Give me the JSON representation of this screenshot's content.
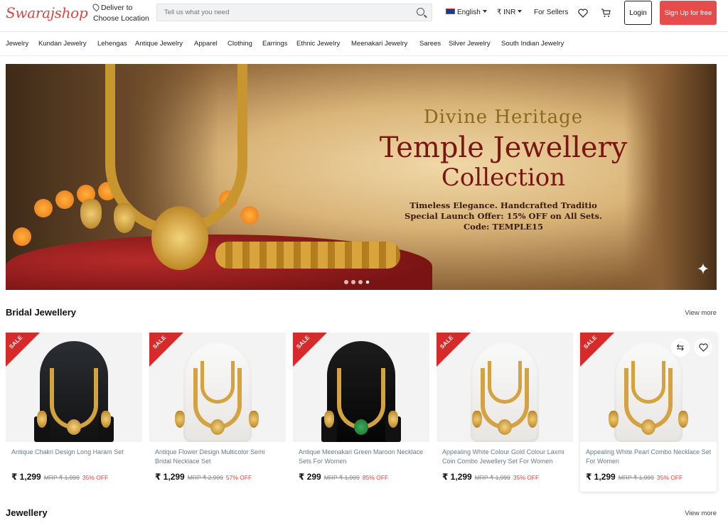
{
  "header": {
    "logo": "Swarajshop",
    "deliver_line1": "Deliver to",
    "deliver_line2": "Choose Location",
    "search_placeholder": "Tell us what you need",
    "language": "English",
    "currency": "₹ INR",
    "sellers": "For Sellers",
    "login": "Login",
    "signup": "Sign Up for free"
  },
  "categories": [
    "Jewelry",
    "Kundan Jewelry",
    "Lehengas",
    "Antique Jewelry",
    "Apparel",
    "Clothing",
    "Earrings",
    "Ethnic Jewelry",
    "Meenakari Jewelry",
    "Sarees",
    "Silver Jewelry",
    "South Indian Jewelry"
  ],
  "banner": {
    "line1": "Divine Heritage",
    "line2": "Temple Jewellery",
    "line3": "Collection",
    "line4": "Timeless Elegance. Handcrafted Traditio",
    "line5": "Special Launch Offer: 15% OFF on All Sets.",
    "line6": "Code: TEMPLE15",
    "slides": 4,
    "active_slide": 4
  },
  "sections": {
    "bridal_title": "Bridal Jewellery",
    "view_more": "View more",
    "jewellery_title": "Jewellery"
  },
  "sale_label": "SALE",
  "products": [
    {
      "name": "Antique Chakri Design Long Haram Set",
      "price": "₹ 1,299",
      "mrp": "MRP ₹ 1,999",
      "off": "35% OFF",
      "bust": "dark"
    },
    {
      "name": "Antique Flower Design Multicolor Semi Bridal Necklace Set",
      "price": "₹ 1,299",
      "mrp": "MRP ₹ 2,999",
      "off": "57% OFF",
      "bust": "white"
    },
    {
      "name": "Antique Meenakari Green Maroon Necklace Sets For Women",
      "price": "₹ 299",
      "mrp": "MRP ₹ 1,999",
      "off": "85% OFF",
      "bust": "black"
    },
    {
      "name": "Appealing White Colour Gold Colour Laxmi Coin Combo Jewellery Set For Women",
      "price": "₹ 1,299",
      "mrp": "MRP ₹ 1,999",
      "off": "35% OFF",
      "bust": "white"
    },
    {
      "name": "Appealing White Pearl Combo Necklace Set For Women",
      "price": "₹ 1,299",
      "mrp": "MRP ₹ 1,999",
      "off": "35% OFF",
      "bust": "white"
    }
  ],
  "colors": {
    "brand": "#e0423f",
    "signup": "#e74c4c",
    "gold": "#d4a23e"
  },
  "icons": [
    "pin-icon",
    "search-icon",
    "flag-icon",
    "heart-icon",
    "cart-icon",
    "compare-icon",
    "wishlist-icon",
    "sparkle-icon"
  ]
}
